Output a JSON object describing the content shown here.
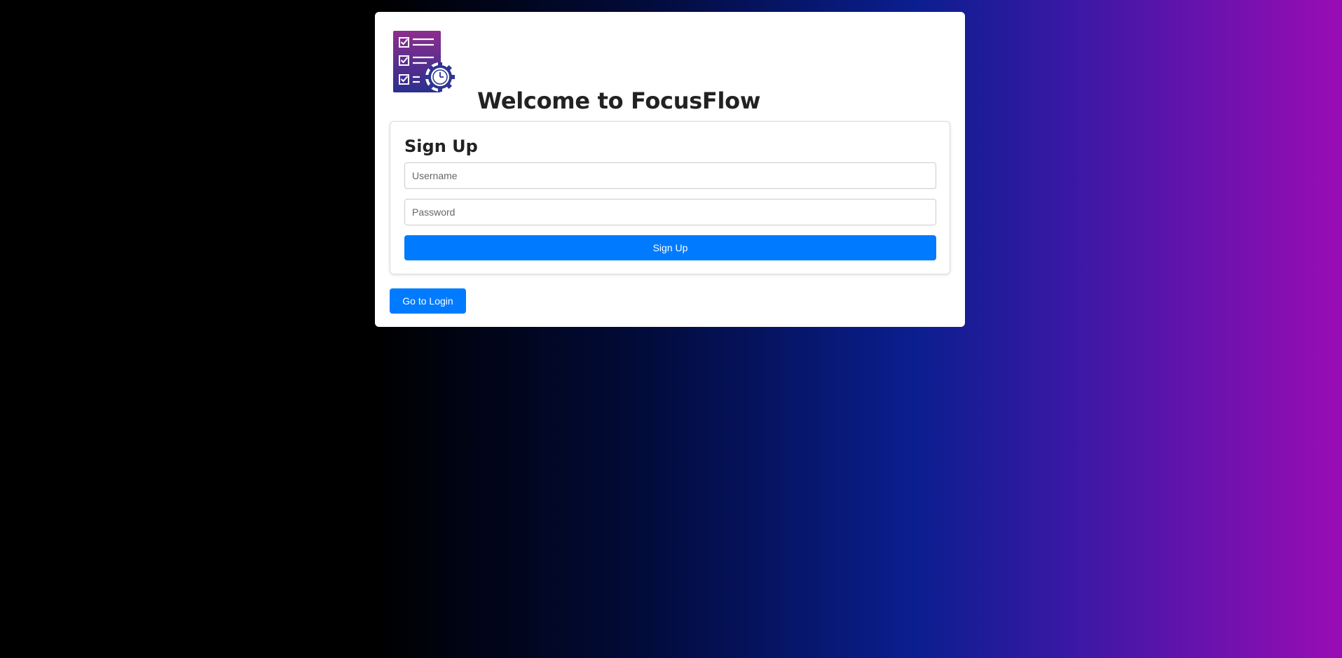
{
  "header": {
    "logo_icon": "checklist-gear-clock-icon",
    "title": "Welcome to FocusFlow"
  },
  "signup": {
    "heading": "Sign Up",
    "username_placeholder": "Username",
    "password_placeholder": "Password",
    "submit_label": "Sign Up"
  },
  "footer": {
    "login_label": "Go to Login"
  },
  "colors": {
    "accent": "#007bff",
    "logo_top": "#8e2d8e",
    "logo_bottom": "#2a2f8f"
  }
}
